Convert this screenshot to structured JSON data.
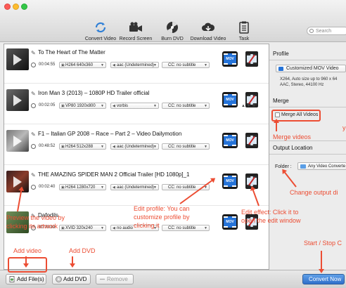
{
  "toolbar": {
    "items": [
      {
        "label": "Convert Video",
        "icon": "convert-icon"
      },
      {
        "label": "Record Screen",
        "icon": "camera-icon"
      },
      {
        "label": "Burn DVD",
        "icon": "disc-icon"
      },
      {
        "label": "Download Video",
        "icon": "cloud-download-icon"
      },
      {
        "label": "Task",
        "icon": "clipboard-icon"
      }
    ],
    "search_placeholder": "Search"
  },
  "videos": [
    {
      "title": "To The Heart of The Matter",
      "duration": "00:04:55",
      "video": "H264 640x360",
      "audio": "aac (Undetermined)",
      "subtitle": "CC: no subtitle"
    },
    {
      "title": "Iron Man 3 (2013) – 1080P HD Trailer official",
      "duration": "00:02:05",
      "video": "VP80 1920x800",
      "audio": "vorbis",
      "subtitle": "CC: no subtitle"
    },
    {
      "title": "F1 – Italian GP 2008 – Race – Part 2 – Video Dailymotion",
      "duration": "00:48:52",
      "video": "H264 512x288",
      "audio": "aac (Undetermined)",
      "subtitle": "CC: no subtitle"
    },
    {
      "title": "THE AMAZING SPIDER MAN 2 Official Trailer [HD 1080p]_1",
      "duration": "00:02:40",
      "video": "H264 1280x720",
      "audio": "aac (Undetermined)",
      "subtitle": "CC: no subtitle"
    },
    {
      "title": "Dafodils",
      "duration": "00:03:09",
      "video": "XVID 320x240",
      "audio": "no audio",
      "subtitle": "CC: no subtitle"
    }
  ],
  "profile_badge": "MOV",
  "reorder_icons": "▲ ▼ ⊗",
  "panel": {
    "profile_heading": "Profile",
    "profile_value": "Customized MOV Video",
    "profile_desc_line1": "X264, Auto size up to 960 x 64",
    "profile_desc_line2": "AAC, Stereo, 44100 Hz",
    "merge_heading": "Merge",
    "merge_label": "Merge All Videos",
    "output_heading": "Output Location",
    "folder_label": "Folder :",
    "folder_value": "Any Video Converte"
  },
  "bottom": {
    "add_files": "Add File(s)",
    "add_dvd": "Add DVD",
    "remove": "Remove",
    "convert_now": "Convert Now"
  },
  "annotations": {
    "merge_videos": "Merge videos",
    "right_edge": "y",
    "change_output": "Change output di",
    "edit_profile_1": "Edit profile: You can",
    "edit_profile_2": "customize profile by",
    "edit_profile_3": "clicking it",
    "edit_effect_1": "Edit effect: Click it to",
    "edit_effect_2": "open the edit window",
    "preview_1": "Preview the video by",
    "preview_2": "clicking its artwork",
    "add_video": "Add video",
    "add_dvd": "Add DVD",
    "start_stop": "Start / Stop C"
  },
  "colors": {
    "accent": "#ec4d33",
    "convert_button": "#3a7bd5",
    "mov_badge": "#2573d8"
  }
}
